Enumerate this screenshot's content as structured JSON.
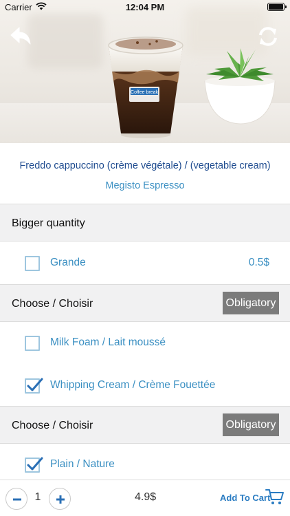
{
  "status_bar": {
    "carrier": "Carrier",
    "time": "12:04 PM"
  },
  "product": {
    "name": "Freddo cappuccino (crème végétale) / (vegetable cream)",
    "shop": "Megisto Espresso",
    "cup_brand": "Coffee break"
  },
  "sections": [
    {
      "title": "Bigger quantity",
      "badge": "",
      "options": [
        {
          "label": "Grande",
          "price": "0.5$",
          "checked": false
        }
      ]
    },
    {
      "title": "Choose / Choisir",
      "badge": "Obligatory",
      "options": [
        {
          "label": "Milk Foam / Lait moussé",
          "price": "",
          "checked": false
        },
        {
          "label": "Whipping Cream / Crème Fouettée",
          "price": "",
          "checked": true
        }
      ]
    },
    {
      "title": "Choose / Choisir",
      "badge": "Obligatory",
      "options": [
        {
          "label": "Plain / Nature",
          "price": "",
          "checked": true
        }
      ]
    }
  ],
  "cart": {
    "quantity": "1",
    "total": "4.9$",
    "add_label": "Add To Cart"
  },
  "icons": {
    "back": "back-arrow-icon",
    "refresh": "refresh-icon",
    "minus": "minus-icon",
    "plus": "plus-icon",
    "cart": "shopping-cart-icon"
  },
  "colors": {
    "accent": "#3a8fc2",
    "title_blue": "#1e4b8f",
    "badge_bg": "#7b7b7b"
  }
}
